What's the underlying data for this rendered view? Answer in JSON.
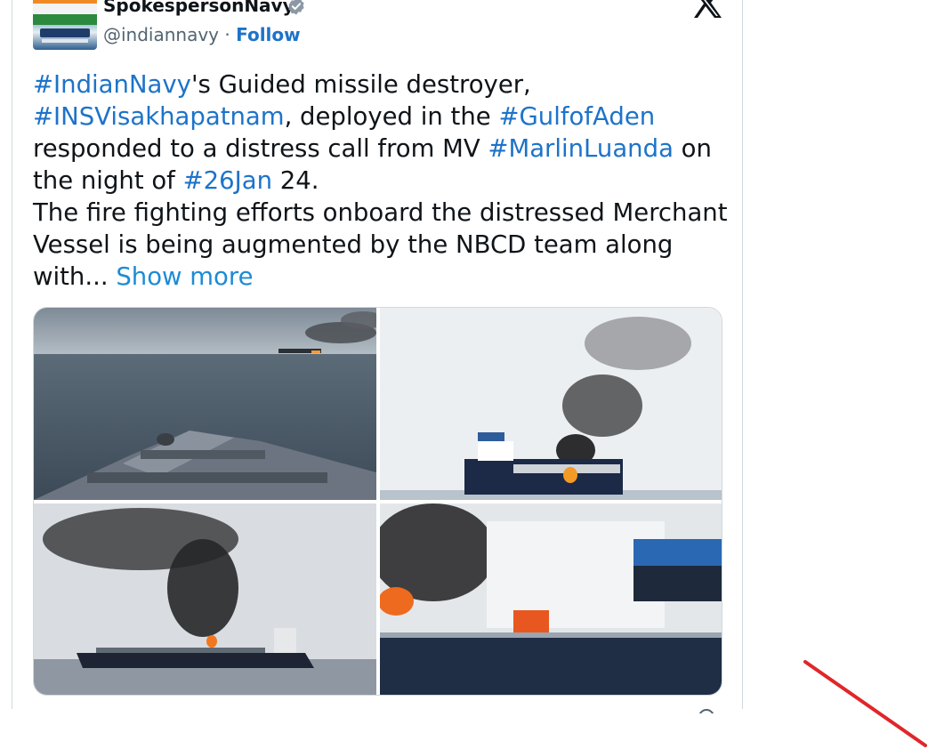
{
  "author": {
    "display_name": "SpokespersonNavy",
    "handle": "@indiannavy",
    "separator": " · ",
    "follow_label": "Follow",
    "verified": true,
    "avatar_icon": "indian-navy-avatar"
  },
  "platform_icon": "x-logo-icon",
  "tweet": {
    "lines": [
      [
        {
          "text": "#IndianNavy",
          "tag": true
        },
        {
          "text": "'s Guided missile destroyer,",
          "tag": false
        }
      ],
      [
        {
          "text": "#INSVisakhapatnam",
          "tag": true
        },
        {
          "text": ", deployed in the ",
          "tag": false
        },
        {
          "text": "#GulfofAden",
          "tag": true
        }
      ],
      [
        {
          "text": "responded to a distress call from MV ",
          "tag": false
        },
        {
          "text": "#MarlinLuanda",
          "tag": true
        },
        {
          "text": " on",
          "tag": false
        }
      ],
      [
        {
          "text": "the night of ",
          "tag": false
        },
        {
          "text": "#26Jan",
          "tag": true
        },
        {
          "text": " 24.",
          "tag": false
        }
      ],
      [
        {
          "text": "The fire fighting efforts onboard the distressed Merchant",
          "tag": false
        }
      ],
      [
        {
          "text": "Vessel is being augmented by the NBCD team along",
          "tag": false
        }
      ]
    ],
    "last_line_text": "with... ",
    "show_more_label": "Show more"
  },
  "media": {
    "photos": [
      {
        "name": "photo-ship-bow-distant-smoke"
      },
      {
        "name": "photo-tanker-fire-close"
      },
      {
        "name": "photo-tanker-fire-wide"
      },
      {
        "name": "photo-tanker-superstructure-fire"
      }
    ]
  },
  "colors": {
    "hashtag": "#1d73c9",
    "show_more": "#1d8bd6",
    "text": "#0f1419",
    "secondary": "#536471",
    "annotation": "#e0262a"
  }
}
